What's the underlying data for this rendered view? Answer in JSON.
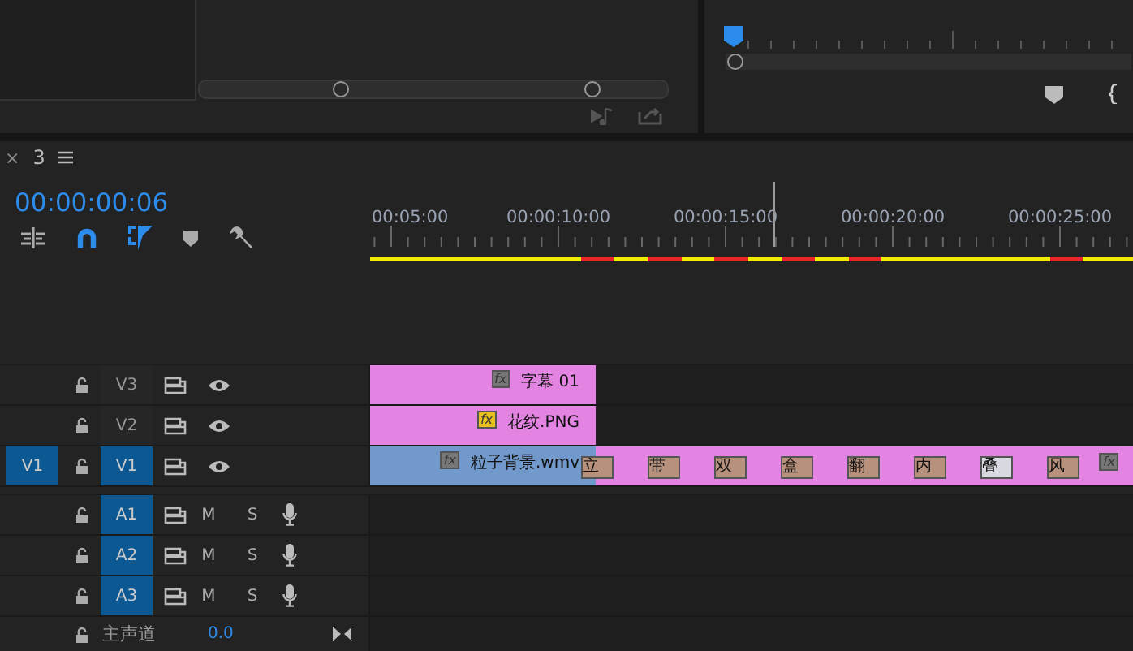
{
  "timeline": {
    "tab": {
      "close": "×",
      "label": "3"
    },
    "timecode": "00:00:00:06",
    "tools": [
      {
        "kind": "nest",
        "on": false
      },
      {
        "kind": "snap",
        "on": true
      },
      {
        "kind": "linked",
        "on": true
      },
      {
        "kind": "marker",
        "on": false
      },
      {
        "kind": "settings",
        "on": false
      }
    ],
    "ruler_labels": [
      "00:05:00",
      "00:00:10:00",
      "00:00:15:00",
      "00:00:20:00",
      "00:00:25:00"
    ],
    "video_tracks": [
      {
        "name": "V3",
        "targeted": false,
        "clips": [
          {
            "label": "字幕 01",
            "color": "#e384e3",
            "badge": "fx",
            "effects_applied": false
          }
        ]
      },
      {
        "name": "V2",
        "targeted": false,
        "clips": [
          {
            "label": "花纹.PNG",
            "color": "#e384e3",
            "badge": "fx",
            "effects_applied": true
          }
        ]
      },
      {
        "source_patch": "V1",
        "name": "V1",
        "targeted": true,
        "clips": [
          {
            "label": "粒子背景.wmv",
            "color": "#7199cb",
            "badge": "fx",
            "effects_applied": false
          },
          {
            "color": "#e384e3",
            "badge": "fx",
            "effects_applied": false
          }
        ],
        "transitions": [
          {
            "label": "立",
            "selected": false
          },
          {
            "label": "带",
            "selected": false
          },
          {
            "label": "双",
            "selected": false
          },
          {
            "label": "盒",
            "selected": false
          },
          {
            "label": "翻",
            "selected": false
          },
          {
            "label": "内",
            "selected": false
          },
          {
            "label": "叠",
            "selected": true
          },
          {
            "label": "风",
            "selected": false
          }
        ]
      }
    ],
    "audio_tracks": [
      {
        "name": "A1",
        "targeted": true,
        "mute": "M",
        "solo": "S"
      },
      {
        "name": "A2",
        "targeted": true,
        "mute": "M",
        "solo": "S"
      },
      {
        "name": "A3",
        "targeted": true,
        "mute": "M",
        "solo": "S"
      }
    ],
    "master": {
      "name": "主声道",
      "value": "0.0"
    }
  }
}
